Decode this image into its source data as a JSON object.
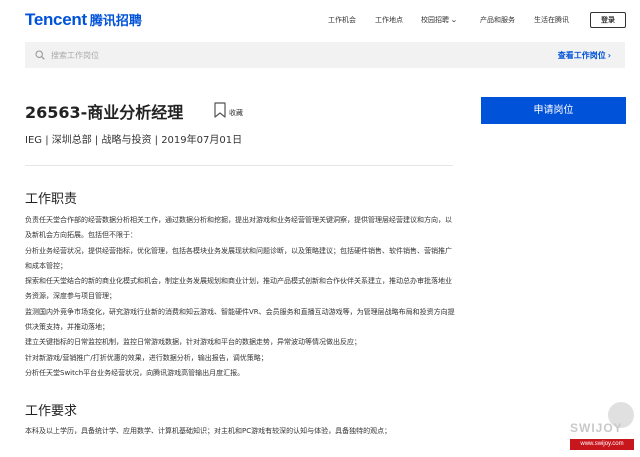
{
  "header": {
    "logo_en": "Tencent",
    "logo_cn": "腾讯招聘",
    "nav": [
      {
        "label": "工作机会",
        "active": false
      },
      {
        "label": "工作地点",
        "active": false
      },
      {
        "label": "校园招聘",
        "active": false
      },
      {
        "label": "产品和服务",
        "active": false
      },
      {
        "label": "生活在腾讯",
        "active": false
      }
    ],
    "login_label": "登录"
  },
  "search": {
    "placeholder": "搜索工作岗位",
    "view_jobs_label": "查看工作岗位",
    "view_jobs_arrow": "›"
  },
  "job": {
    "title": "26563-商业分析经理",
    "favorite_label": "收藏",
    "meta": "IEG | 深圳总部 | 战略与投资 | 2019年07月01日",
    "apply_label": "申请岗位"
  },
  "responsibilities": {
    "title": "工作职责",
    "lines": [
      "负责任天堂合作部的经营数据分析相关工作，通过数据分析和挖掘，提出对游戏和业务经营管理关键洞察，提供管理层经营建议和方向，以及新机会方向拓展。包括但不限于：",
      "分析业务经营状况，提供经营指标，优化管理，包括各模块业务发展现状和问题诊断，以及策略建议；包括硬件销售、软件销售、营销推广和成本管控；",
      "探索和任天堂结合的新的商业化模式和机会，制定业务发展规划和商业计划，推动产品模式创新和合作伙伴关系建立，推动总办审批落地业务资源，深度参与项目管理；",
      "监测国内外竞争市场变化，研究游戏行业新的消费和知云游戏、智能硬件VR、会员服务和直播互动游戏等，为管理层战略布局和投资方向提供决策支持，并推动落地；",
      "建立关键指标的日常监控机制，监控日常游戏数据，针对游戏和平台的数据走势，异常波动等情况做出反应；",
      "针对新游戏/营销推广/打折优惠的效果，进行数据分析，输出报告，调优策略；",
      "分析任天堂Switch平台业务经营状况，向腾讯游戏高管输出月度汇报。"
    ]
  },
  "requirements": {
    "title": "工作要求",
    "lines": [
      "本科及以上学历，具备统计学、应用数学、计算机基础知识；对主机和PC游戏有较深的认知与体验，具备独特的观点；"
    ]
  },
  "watermark": {
    "text": "SWIJOY",
    "domain": "www.swijoy.com"
  },
  "colors": {
    "brand": "#0052d9",
    "text": "#333333",
    "search_bg": "#f2f2f2"
  }
}
